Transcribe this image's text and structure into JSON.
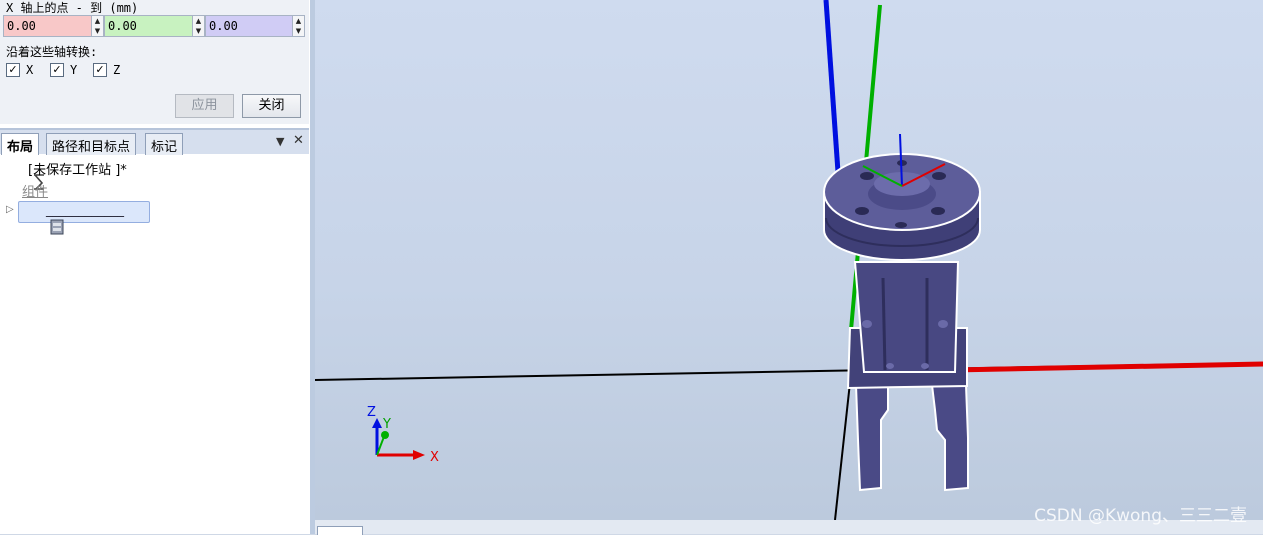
{
  "props": {
    "row_label": "X 轴上的点 - 到 (mm)",
    "x_value": "0.00",
    "y_value": "0.00",
    "z_value": "0.00",
    "axes_label": "沿着这些轴转换:",
    "axis_x": "X",
    "axis_y": "Y",
    "axis_z": "Z",
    "apply_label": "应用",
    "close_label": "关闭",
    "colors": {
      "x_field": "#f8c8c8",
      "y_field": "#c8f2c0",
      "z_field": "#d0ccf5"
    }
  },
  "tabs": {
    "layout": "布局",
    "paths": "路径和目标点",
    "markers": "标记"
  },
  "tree": {
    "station": "[未保存工作站 ]*",
    "group": "组件",
    "item": "____________"
  },
  "viewport": {
    "axis_x": "X",
    "axis_y": "Y",
    "axis_z": "Z",
    "watermark": "CSDN @Kwong、三三二壹",
    "colors": {
      "x": "#e00000",
      "y": "#00b000",
      "z": "#0010e0",
      "part": "#4a4a86"
    }
  },
  "icons": [
    "spin-up-icon",
    "spin-down-icon",
    "checkbox-checked-icon",
    "station-icon",
    "component-icon",
    "expand-arrow-icon",
    "pin-icon",
    "close-icon"
  ]
}
